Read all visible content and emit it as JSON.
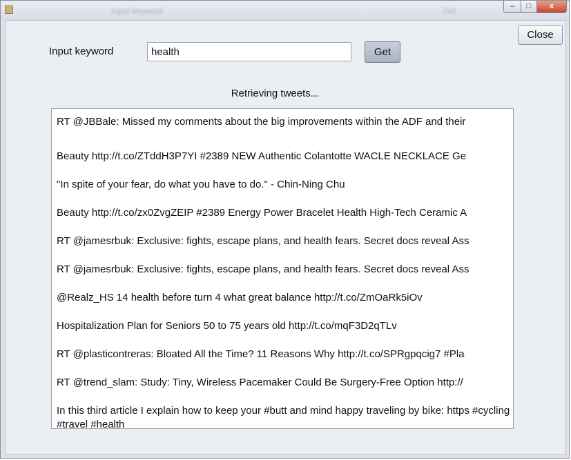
{
  "window": {
    "title": "Input keyword",
    "ghost_button": "Get",
    "controls": {
      "minimize": "–",
      "maximize": "□",
      "close": "x"
    }
  },
  "close_button": {
    "label": "Close"
  },
  "search": {
    "label": "Input keyword",
    "value": "health",
    "get_label": "Get"
  },
  "status": {
    "text": "Retrieving tweets..."
  },
  "tweets": [
    "RT @JBBale: Missed my comments about the big improvements within the ADF and their",
    "Beauty http://t.co/ZTddH3P7YI #2389 NEW Authentic Colantotte WACLE NECKLACE Ge",
    "\"In spite of your fear, do what you have to do.\" - Chin-Ning Chu",
    "Beauty http://t.co/zx0ZvgZEIP #2389 Energy Power Bracelet Health High-Tech Ceramic A",
    "RT @jamesrbuk: Exclusive: fights, escape plans, and health fears. Secret docs reveal Ass",
    "RT @jamesrbuk: Exclusive: fights, escape plans, and health fears. Secret docs reveal Ass",
    "@Realz_HS 14 health before turn 4 what great balance http://t.co/ZmOaRk5iOv",
    "Hospitalization Plan for Seniors 50 to 75 years old http://t.co/mqF3D2qTLv",
    "RT @plasticontreras: Bloated All the Time? 11 Reasons Why http://t.co/SPRgpqcig7 #Pla",
    "RT @trend_slam: Study: Tiny, Wireless Pacemaker Could Be Surgery-Free Option http://",
    "In this third article I explain how to keep your #butt and mind happy traveling by bike: https #cycling #travel #health"
  ]
}
